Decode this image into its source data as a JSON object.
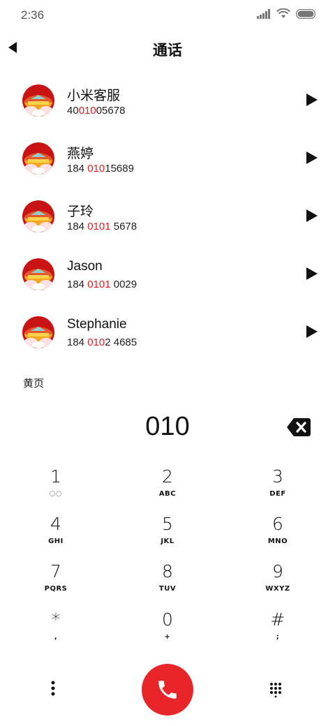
{
  "status_bar": {
    "time": "2:36"
  },
  "header": {
    "title": "通话"
  },
  "contacts": [
    {
      "name": "小米客服",
      "number_parts": [
        "40",
        "010",
        "05678"
      ]
    },
    {
      "name": "燕婷",
      "number_parts": [
        "184 ",
        "010",
        "15689"
      ]
    },
    {
      "name": "子玲",
      "number_parts": [
        "184 ",
        "0101",
        " 5678"
      ]
    },
    {
      "name": "Jason",
      "number_parts": [
        "184 ",
        "0101",
        " 0029"
      ]
    },
    {
      "name": "Stephanie",
      "number_parts": [
        "184 ",
        "010",
        "2 4685"
      ]
    }
  ],
  "section": {
    "label": "黄页"
  },
  "dialer": {
    "input_value": "010"
  },
  "keypad": [
    {
      "digit": "1",
      "letters": "◌◌"
    },
    {
      "digit": "2",
      "letters": "ABC"
    },
    {
      "digit": "3",
      "letters": "DEF"
    },
    {
      "digit": "4",
      "letters": "GHI"
    },
    {
      "digit": "5",
      "letters": "JKL"
    },
    {
      "digit": "6",
      "letters": "MNO"
    },
    {
      "digit": "7",
      "letters": "PQRS"
    },
    {
      "digit": "8",
      "letters": "TUV"
    },
    {
      "digit": "9",
      "letters": "WXYZ"
    },
    {
      "digit": "*",
      "letters": ","
    },
    {
      "digit": "0",
      "letters": "+"
    },
    {
      "digit": "#",
      "letters": ";"
    }
  ],
  "colors": {
    "highlight": "#e02020",
    "call_button": "#e8262a"
  },
  "icons": {
    "back": "back-arrow-icon",
    "play": "play-icon",
    "backspace": "backspace-icon",
    "menu": "more-vertical-icon",
    "call": "phone-icon",
    "keypad_toggle": "dialpad-icon"
  }
}
